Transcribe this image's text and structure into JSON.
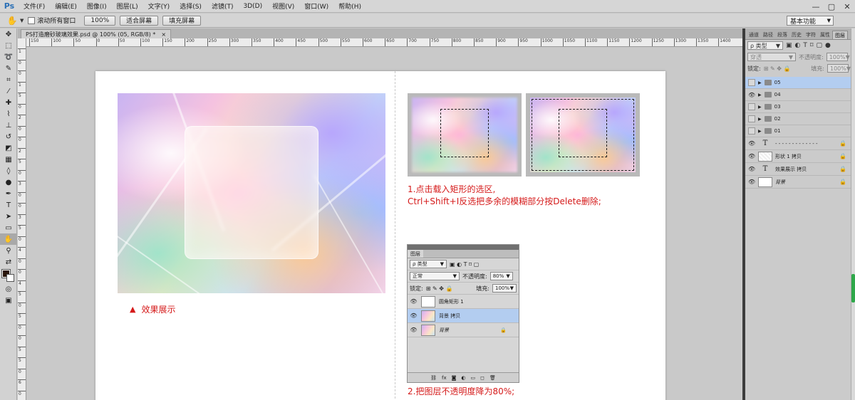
{
  "app": {
    "logo": "Ps"
  },
  "menu": [
    "文件(F)",
    "编辑(E)",
    "图像(I)",
    "图层(L)",
    "文字(Y)",
    "选择(S)",
    "滤镜(T)",
    "3D(D)",
    "视图(V)",
    "窗口(W)",
    "帮助(H)"
  ],
  "window_controls": [
    "—",
    "▢",
    "✕"
  ],
  "options": {
    "scroll_all_label": "滚动所有窗口",
    "zoom_value": "100%",
    "fit_screen": "适合屏幕",
    "fill_screen": "填充屏幕",
    "workspace": "基本功能"
  },
  "document": {
    "tab_title": "PS打造磨砂玻璃效果.psd @ 100% (05, RGB/8) *",
    "close": "×"
  },
  "ruler": {
    "h_ticks": [
      "150",
      "100",
      "50",
      "0",
      "50",
      "100",
      "150",
      "200",
      "250",
      "300",
      "350",
      "400",
      "450",
      "500",
      "550",
      "600",
      "650",
      "700",
      "750",
      "800",
      "850",
      "900",
      "950",
      "1000",
      "1050",
      "1100",
      "1150",
      "1200",
      "1250",
      "1300",
      "1350",
      "1400"
    ],
    "v_ticks": [
      "1",
      "0",
      "0",
      "1",
      "5",
      "0",
      "2",
      "0",
      "0",
      "2",
      "5",
      "0",
      "3",
      "0",
      "0",
      "3",
      "5",
      "0",
      "4",
      "0",
      "0",
      "4",
      "5",
      "0",
      "5",
      "0",
      "0",
      "5",
      "5",
      "0",
      "6",
      "0"
    ]
  },
  "canvas": {
    "caption_marker": "▲",
    "caption": "效果展示",
    "step1_line1": "1.点击载入矩形的选区,",
    "step1_line2": "Ctrl+Shift+I反选把多余的模糊部分按Delete删除;",
    "step2": "2.把图层不透明度降为80%;",
    "mini_panel": {
      "tab": "图层",
      "kind": "ρ 类型",
      "blend": "正常",
      "opacity_label": "不透明度:",
      "opacity": "80%",
      "lock_label": "锁定:",
      "fill_label": "填充:",
      "fill": "100%",
      "layers": [
        {
          "name": "圆角矩形 1",
          "type": "shape",
          "selected": false
        },
        {
          "name": "背景 拷贝",
          "type": "image",
          "selected": true
        },
        {
          "name": "背景",
          "type": "image",
          "selected": false
        }
      ]
    }
  },
  "panel": {
    "tabs": [
      "通道",
      "路径",
      "段落",
      "历史",
      "字符",
      "属性",
      "图层"
    ],
    "kind": "ρ 类型",
    "blend": "穿透",
    "opacity_label": "不透明度:",
    "opacity": "100%",
    "lock_label": "锁定:",
    "fill_label": "填充:",
    "fill": "100%",
    "layers": [
      {
        "name": "05",
        "type": "group",
        "visible": false,
        "selected": true
      },
      {
        "name": "04",
        "type": "group",
        "visible": true,
        "selected": false
      },
      {
        "name": "03",
        "type": "group",
        "visible": false,
        "selected": false
      },
      {
        "name": "02",
        "type": "group",
        "visible": false,
        "selected": false
      },
      {
        "name": "01",
        "type": "group",
        "visible": false,
        "selected": false
      },
      {
        "name": "- - - - - - - - - - - - -",
        "type": "text",
        "visible": true,
        "selected": false
      },
      {
        "name": "形状 1 拷贝",
        "type": "shape",
        "visible": true,
        "selected": false
      },
      {
        "name": "效果展示 拷贝",
        "type": "text",
        "visible": true,
        "selected": false
      },
      {
        "name": "背景",
        "type": "background",
        "visible": true,
        "selected": false
      }
    ]
  },
  "colors": {
    "accent_red": "#d51a1a",
    "selection_blue": "#b3cdf0",
    "foreground": "#2a160a",
    "background": "#ffffff"
  }
}
